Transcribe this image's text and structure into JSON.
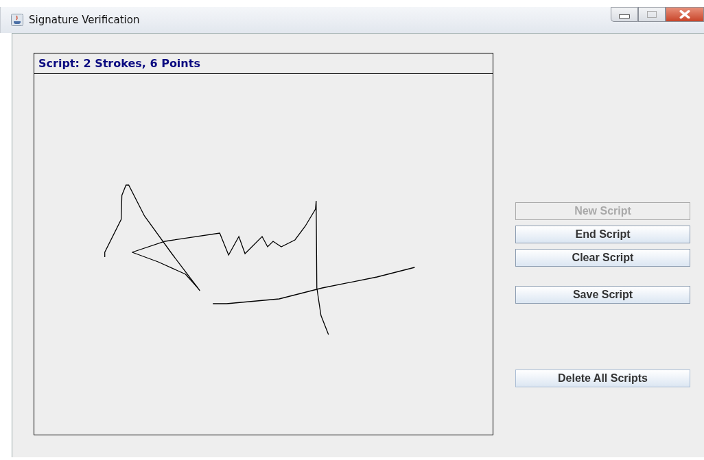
{
  "window": {
    "title": "Signature Verification"
  },
  "panel": {
    "header": "Script: 2 Strokes, 6 Points"
  },
  "button_groups": [
    [
      {
        "label": "New Script",
        "disabled": true,
        "focused": false
      },
      {
        "label": "End Script",
        "disabled": false,
        "focused": false
      },
      {
        "label": "Clear Script",
        "disabled": false,
        "focused": false
      }
    ],
    [
      {
        "label": "Save Script",
        "disabled": false,
        "focused": false
      }
    ],
    [
      {
        "label": "Delete All Scripts",
        "disabled": false,
        "focused": true
      }
    ]
  ]
}
